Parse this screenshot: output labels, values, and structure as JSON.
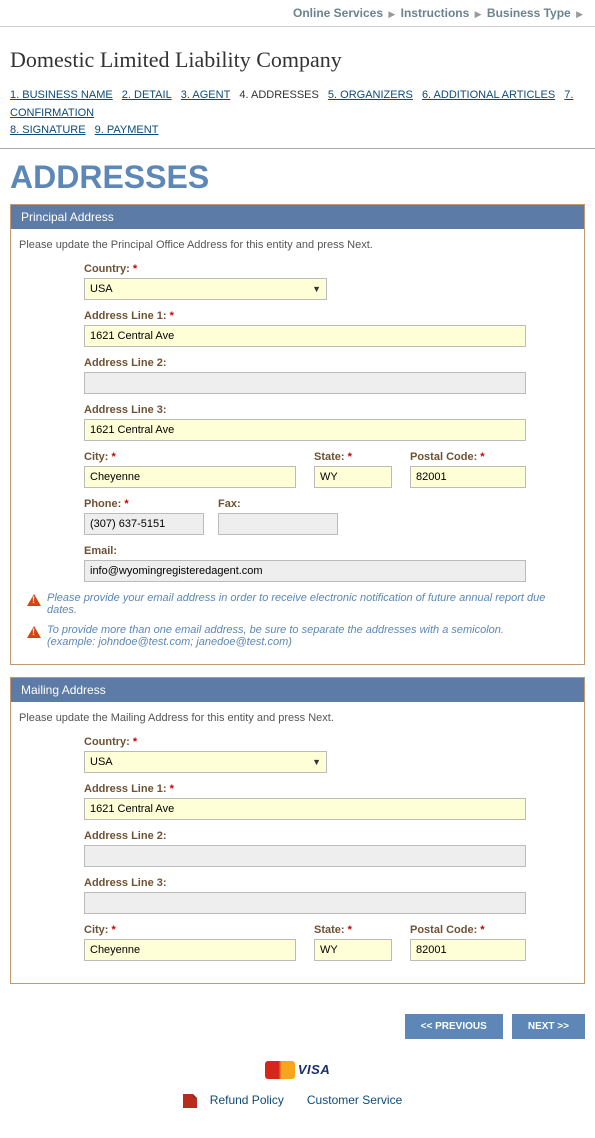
{
  "topnav": {
    "online_services": "Online Services",
    "instructions": "Instructions",
    "business_type": "Business Type"
  },
  "company_title": "Domestic Limited Liability Company",
  "steps": {
    "s1": "1. BUSINESS NAME",
    "s2": "2. DETAIL",
    "s3": "3. AGENT",
    "s4": "4. ADDRESSES",
    "s5": "5. ORGANIZERS",
    "s6": "6. ADDITIONAL ARTICLES",
    "s7": "7. CONFIRMATION",
    "s8": "8. SIGNATURE",
    "s9": "9. PAYMENT"
  },
  "page_title": "ADDRESSES",
  "principal": {
    "header": "Principal Address",
    "instr": "Please update the Principal Office Address for this entity and press Next.",
    "labels": {
      "country": "Country:",
      "addr1": "Address Line 1:",
      "addr2": "Address Line 2:",
      "addr3": "Address Line 3:",
      "city": "City:",
      "state": "State:",
      "postal": "Postal Code:",
      "phone": "Phone:",
      "fax": "Fax:",
      "email": "Email:"
    },
    "values": {
      "country": "USA",
      "addr1": "1621 Central Ave",
      "addr2": "",
      "addr3": "1621 Central Ave",
      "city": "Cheyenne",
      "state": "WY",
      "postal": "82001",
      "phone": "(307) 637-5151",
      "fax": "",
      "email": "info@wyomingregisteredagent.com"
    },
    "warn1": "Please provide your email address in order to receive electronic notification of future annual report due dates.",
    "warn2a": "To provide more than one email address, be sure to separate the addresses with a semicolon.",
    "warn2b": "(example: johndoe@test.com; janedoe@test.com)"
  },
  "mailing": {
    "header": "Mailing Address",
    "instr": "Please update the Mailing Address for this entity and press Next.",
    "labels": {
      "country": "Country:",
      "addr1": "Address Line 1:",
      "addr2": "Address Line 2:",
      "addr3": "Address Line 3:",
      "city": "City:",
      "state": "State:",
      "postal": "Postal Code:"
    },
    "values": {
      "country": "USA",
      "addr1": "1621 Central Ave",
      "addr2": "",
      "addr3": "",
      "city": "Cheyenne",
      "state": "WY",
      "postal": "82001"
    }
  },
  "buttons": {
    "prev": "<< PREVIOUS",
    "next": "NEXT >>"
  },
  "footer": {
    "refund": "Refund Policy",
    "customer": "Customer Service",
    "visa": "VISA"
  },
  "req": "*"
}
